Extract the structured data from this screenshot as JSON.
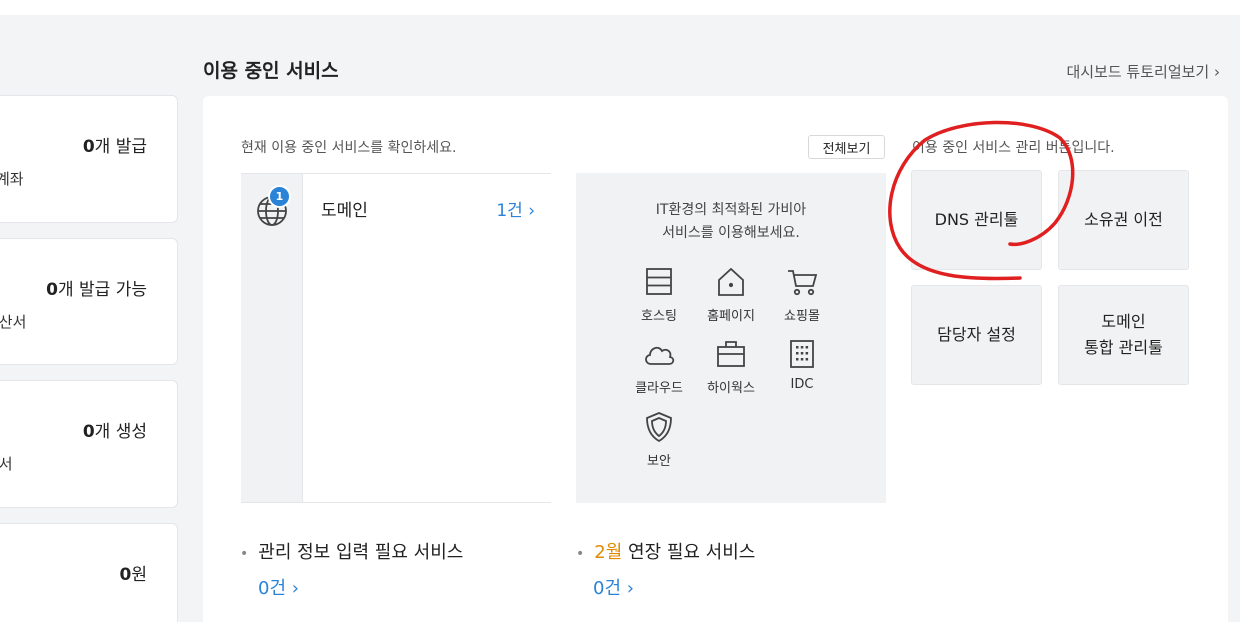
{
  "left_cards": [
    {
      "value_num": "0",
      "value_suffix": "개 발급",
      "sub": "계좌"
    },
    {
      "value_num": "0",
      "value_suffix": "개 발급 가능",
      "sub": "계산서"
    },
    {
      "value_num": "0",
      "value_suffix": "개 생성",
      "sub": "문서"
    },
    {
      "value_num": "0",
      "value_suffix": "원",
      "sub": ""
    }
  ],
  "header": {
    "title": "이용 중인 서비스",
    "tutorial_link": "대시보드 튜토리얼보기 ›"
  },
  "services": {
    "description": "현재 이용 중인 서비스를 확인하세요.",
    "view_all": "전체보기",
    "items": [
      {
        "name": "도메인",
        "count": "1건 ›",
        "badge": "1",
        "icon": "globe-icon"
      }
    ]
  },
  "promo": {
    "line1": "IT환경의 최적화된 가비아",
    "line2": "서비스를 이용해보세요.",
    "items": [
      {
        "label": "호스팅",
        "icon": "server-icon"
      },
      {
        "label": "홈페이지",
        "icon": "home-icon"
      },
      {
        "label": "쇼핑몰",
        "icon": "cart-icon"
      },
      {
        "label": "클라우드",
        "icon": "cloud-icon"
      },
      {
        "label": "하이웍스",
        "icon": "briefcase-icon"
      },
      {
        "label": "IDC",
        "icon": "building-icon"
      },
      {
        "label": "보안",
        "icon": "shield-icon"
      }
    ]
  },
  "tools": {
    "description": "이용 중인 서비스 관리 버튼입니다.",
    "dns": "DNS 관리툴",
    "transfer": "소유권 이전",
    "contact": "담당자 설정",
    "domain_line1": "도메인",
    "domain_line2": "통합 관리툴"
  },
  "bottom": {
    "info_label": "관리 정보 입력 필요 서비스",
    "info_count": "0건 ›",
    "renew_month": "2월",
    "renew_label": " 연장 필요 서비스",
    "renew_count": "0건 ›"
  },
  "colors": {
    "accent": "#2b83d8",
    "month": "#e08a00",
    "annotation": "#e02020"
  }
}
